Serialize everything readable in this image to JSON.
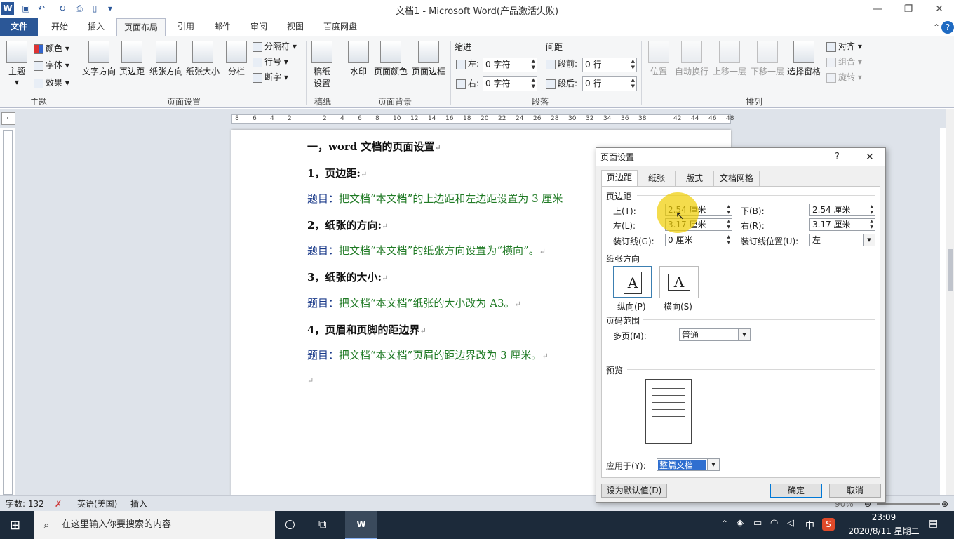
{
  "app": {
    "title": "文档1 - Microsoft Word(产品激活失败)"
  },
  "tabs": [
    {
      "label": "文件"
    },
    {
      "label": "开始"
    },
    {
      "label": "插入"
    },
    {
      "label": "页面布局"
    },
    {
      "label": "引用"
    },
    {
      "label": "邮件"
    },
    {
      "label": "审阅"
    },
    {
      "label": "视图"
    },
    {
      "label": "百度网盘"
    }
  ],
  "ribbon": {
    "theme": {
      "main": "主题",
      "colors": "颜色",
      "fonts": "字体",
      "effects": "效果",
      "group": "主题"
    },
    "page_setup": {
      "text_direction": "文字方向",
      "margins": "页边距",
      "orientation": "纸张方向",
      "size": "纸张大小",
      "columns": "分栏",
      "breaks": "分隔符",
      "line_numbers": "行号",
      "hyphenation": "断字",
      "group": "页面设置"
    },
    "draft": {
      "label": "稿纸设置",
      "group": "稿纸"
    },
    "background": {
      "watermark": "水印",
      "page_color": "页面颜色",
      "page_borders": "页面边框",
      "group": "页面背景"
    },
    "paragraph": {
      "indent": "缩进",
      "spacing": "间距",
      "left_label": "左:",
      "left_value": "0 字符",
      "right_label": "右:",
      "right_value": "0 字符",
      "before_label": "段前:",
      "before_value": "0 行",
      "after_label": "段后:",
      "after_value": "0 行",
      "group": "段落"
    },
    "arrange": {
      "position": "位置",
      "wrap": "自动换行",
      "forward": "上移一层",
      "backward": "下移一层",
      "selection_pane": "选择窗格",
      "align": "对齐",
      "group_btn": "组合",
      "rotate": "旋转",
      "group": "排列"
    }
  },
  "ruler": {
    "ticks": [
      "8",
      "6",
      "4",
      "2",
      "",
      "2",
      "4",
      "6",
      "8",
      "10",
      "12",
      "14",
      "16",
      "18",
      "20",
      "22",
      "24",
      "26",
      "28",
      "30",
      "32",
      "34",
      "36",
      "38",
      "",
      "42",
      "44",
      "46",
      "48"
    ]
  },
  "document": {
    "lines": [
      {
        "text": "一，word 文档的页面设置",
        "style": "h"
      },
      {
        "text": "1，页边距:",
        "style": "h"
      },
      {
        "label": "题目：",
        "text": "把文档“本文档”的上边距和左边距设置为 3 厘米",
        "style": "q"
      },
      {
        "text": "2，纸张的方向:",
        "style": "h"
      },
      {
        "label": "题目：",
        "text": "把文档“本文档”的纸张方向设置为“横向”。",
        "style": "q"
      },
      {
        "text": "3，纸张的大小:",
        "style": "h"
      },
      {
        "label": "题目：",
        "text": "把文档“本文档”纸张的大小改为 A3。",
        "style": "q"
      },
      {
        "text": "4，页眉和页脚的距边界",
        "style": "h"
      },
      {
        "label": "题目：",
        "text": "把文档“本文档”页眉的距边界改为 3 厘米。",
        "style": "q"
      }
    ]
  },
  "dialog": {
    "title": "页面设置",
    "help": "?",
    "close": "✕",
    "tabs": [
      "页边距",
      "纸张",
      "版式",
      "文档网格"
    ],
    "margins_section": "页边距",
    "top_label": "上(T):",
    "top_value": "2.54 厘米",
    "bottom_label": "下(B):",
    "bottom_value": "2.54 厘米",
    "left_label": "左(L):",
    "left_value": "3.17 厘米",
    "right_label": "右(R):",
    "right_value": "3.17 厘米",
    "gutter_label": "装订线(G):",
    "gutter_value": "0 厘米",
    "gutter_pos_label": "装订线位置(U):",
    "gutter_pos_value": "左",
    "orientation_section": "纸张方向",
    "portrait": "纵向(P)",
    "landscape": "横向(S)",
    "pages_section": "页码范围",
    "multiple_label": "多页(M):",
    "multiple_value": "普通",
    "preview_section": "预览",
    "apply_label": "应用于(Y):",
    "apply_value": "整篇文档",
    "default_btn": "设为默认值(D)",
    "ok_btn": "确定",
    "cancel_btn": "取消"
  },
  "status": {
    "words": "字数: 132",
    "lang": "英语(美国)",
    "mode": "插入",
    "zoom": "90%"
  },
  "taskbar": {
    "search": "在这里输入你要搜索的内容",
    "time": "23:09",
    "date": "2020/8/11 星期二",
    "ime": "中"
  }
}
